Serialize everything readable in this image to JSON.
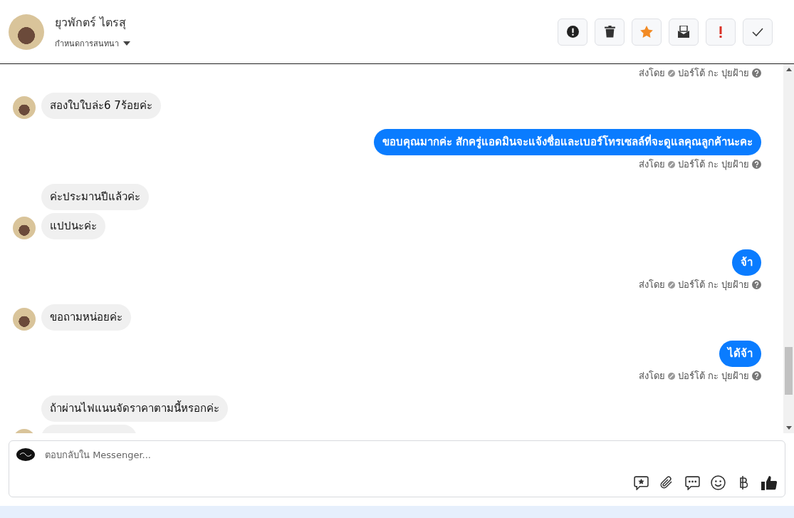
{
  "header": {
    "name": "ยุวพักตร์ ไตรสุ",
    "assign_label": "กำหนดการสนทนา"
  },
  "actions": [
    {
      "kind": "alert"
    },
    {
      "kind": "trash"
    },
    {
      "kind": "star"
    },
    {
      "kind": "mail"
    },
    {
      "kind": "important"
    },
    {
      "kind": "check"
    }
  ],
  "messages": [
    {
      "kind": "meta",
      "label": "ส่งโดย",
      "sender": "ปอร์โต้ กะ ปุยฝ้าย"
    },
    {
      "kind": "incoming",
      "text": "สองใบใบล่ะ6 7ร้อยค่ะ",
      "avatar": true
    },
    {
      "kind": "outgoing",
      "text": "ขอบคุณมากค่ะ  สักครู่แอดมินจะแจ้งชื่อและเบอร์โทรเซลล์ที่จะดูแลคุณลูกค้านะคะ"
    },
    {
      "kind": "meta",
      "label": "ส่งโดย",
      "sender": "ปอร์โต้ กะ ปุยฝ้าย"
    },
    {
      "kind": "incoming",
      "text": "ค่ะประมานปีแล้วค่ะ",
      "avatar": false
    },
    {
      "kind": "incoming",
      "text": "แปปนะค่ะ",
      "avatar": true
    },
    {
      "kind": "outgoing",
      "text": "จ้า"
    },
    {
      "kind": "meta",
      "label": "ส่งโดย",
      "sender": "ปอร์โต้ กะ ปุยฝ้าย"
    },
    {
      "kind": "incoming",
      "text": "ขอถามหน่อยค่ะ",
      "avatar": true
    },
    {
      "kind": "outgoing",
      "text": "ได้จ้า"
    },
    {
      "kind": "meta",
      "label": "ส่งโดย",
      "sender": "ปอร์โต้ กะ ปุยฝ้าย"
    },
    {
      "kind": "incoming",
      "text": "ถ้าผ่านไฟแนนจัดราคาตามนี้หรอกค่ะ",
      "avatar": false
    },
    {
      "kind": "partial",
      "avatar": true
    }
  ],
  "composer": {
    "placeholder": "ตอบกลับใน Messenger...",
    "tools": [
      {
        "kind": "sticker"
      },
      {
        "kind": "attach"
      },
      {
        "kind": "chat"
      },
      {
        "kind": "emoji"
      },
      {
        "kind": "baht"
      },
      {
        "kind": "like"
      }
    ]
  }
}
